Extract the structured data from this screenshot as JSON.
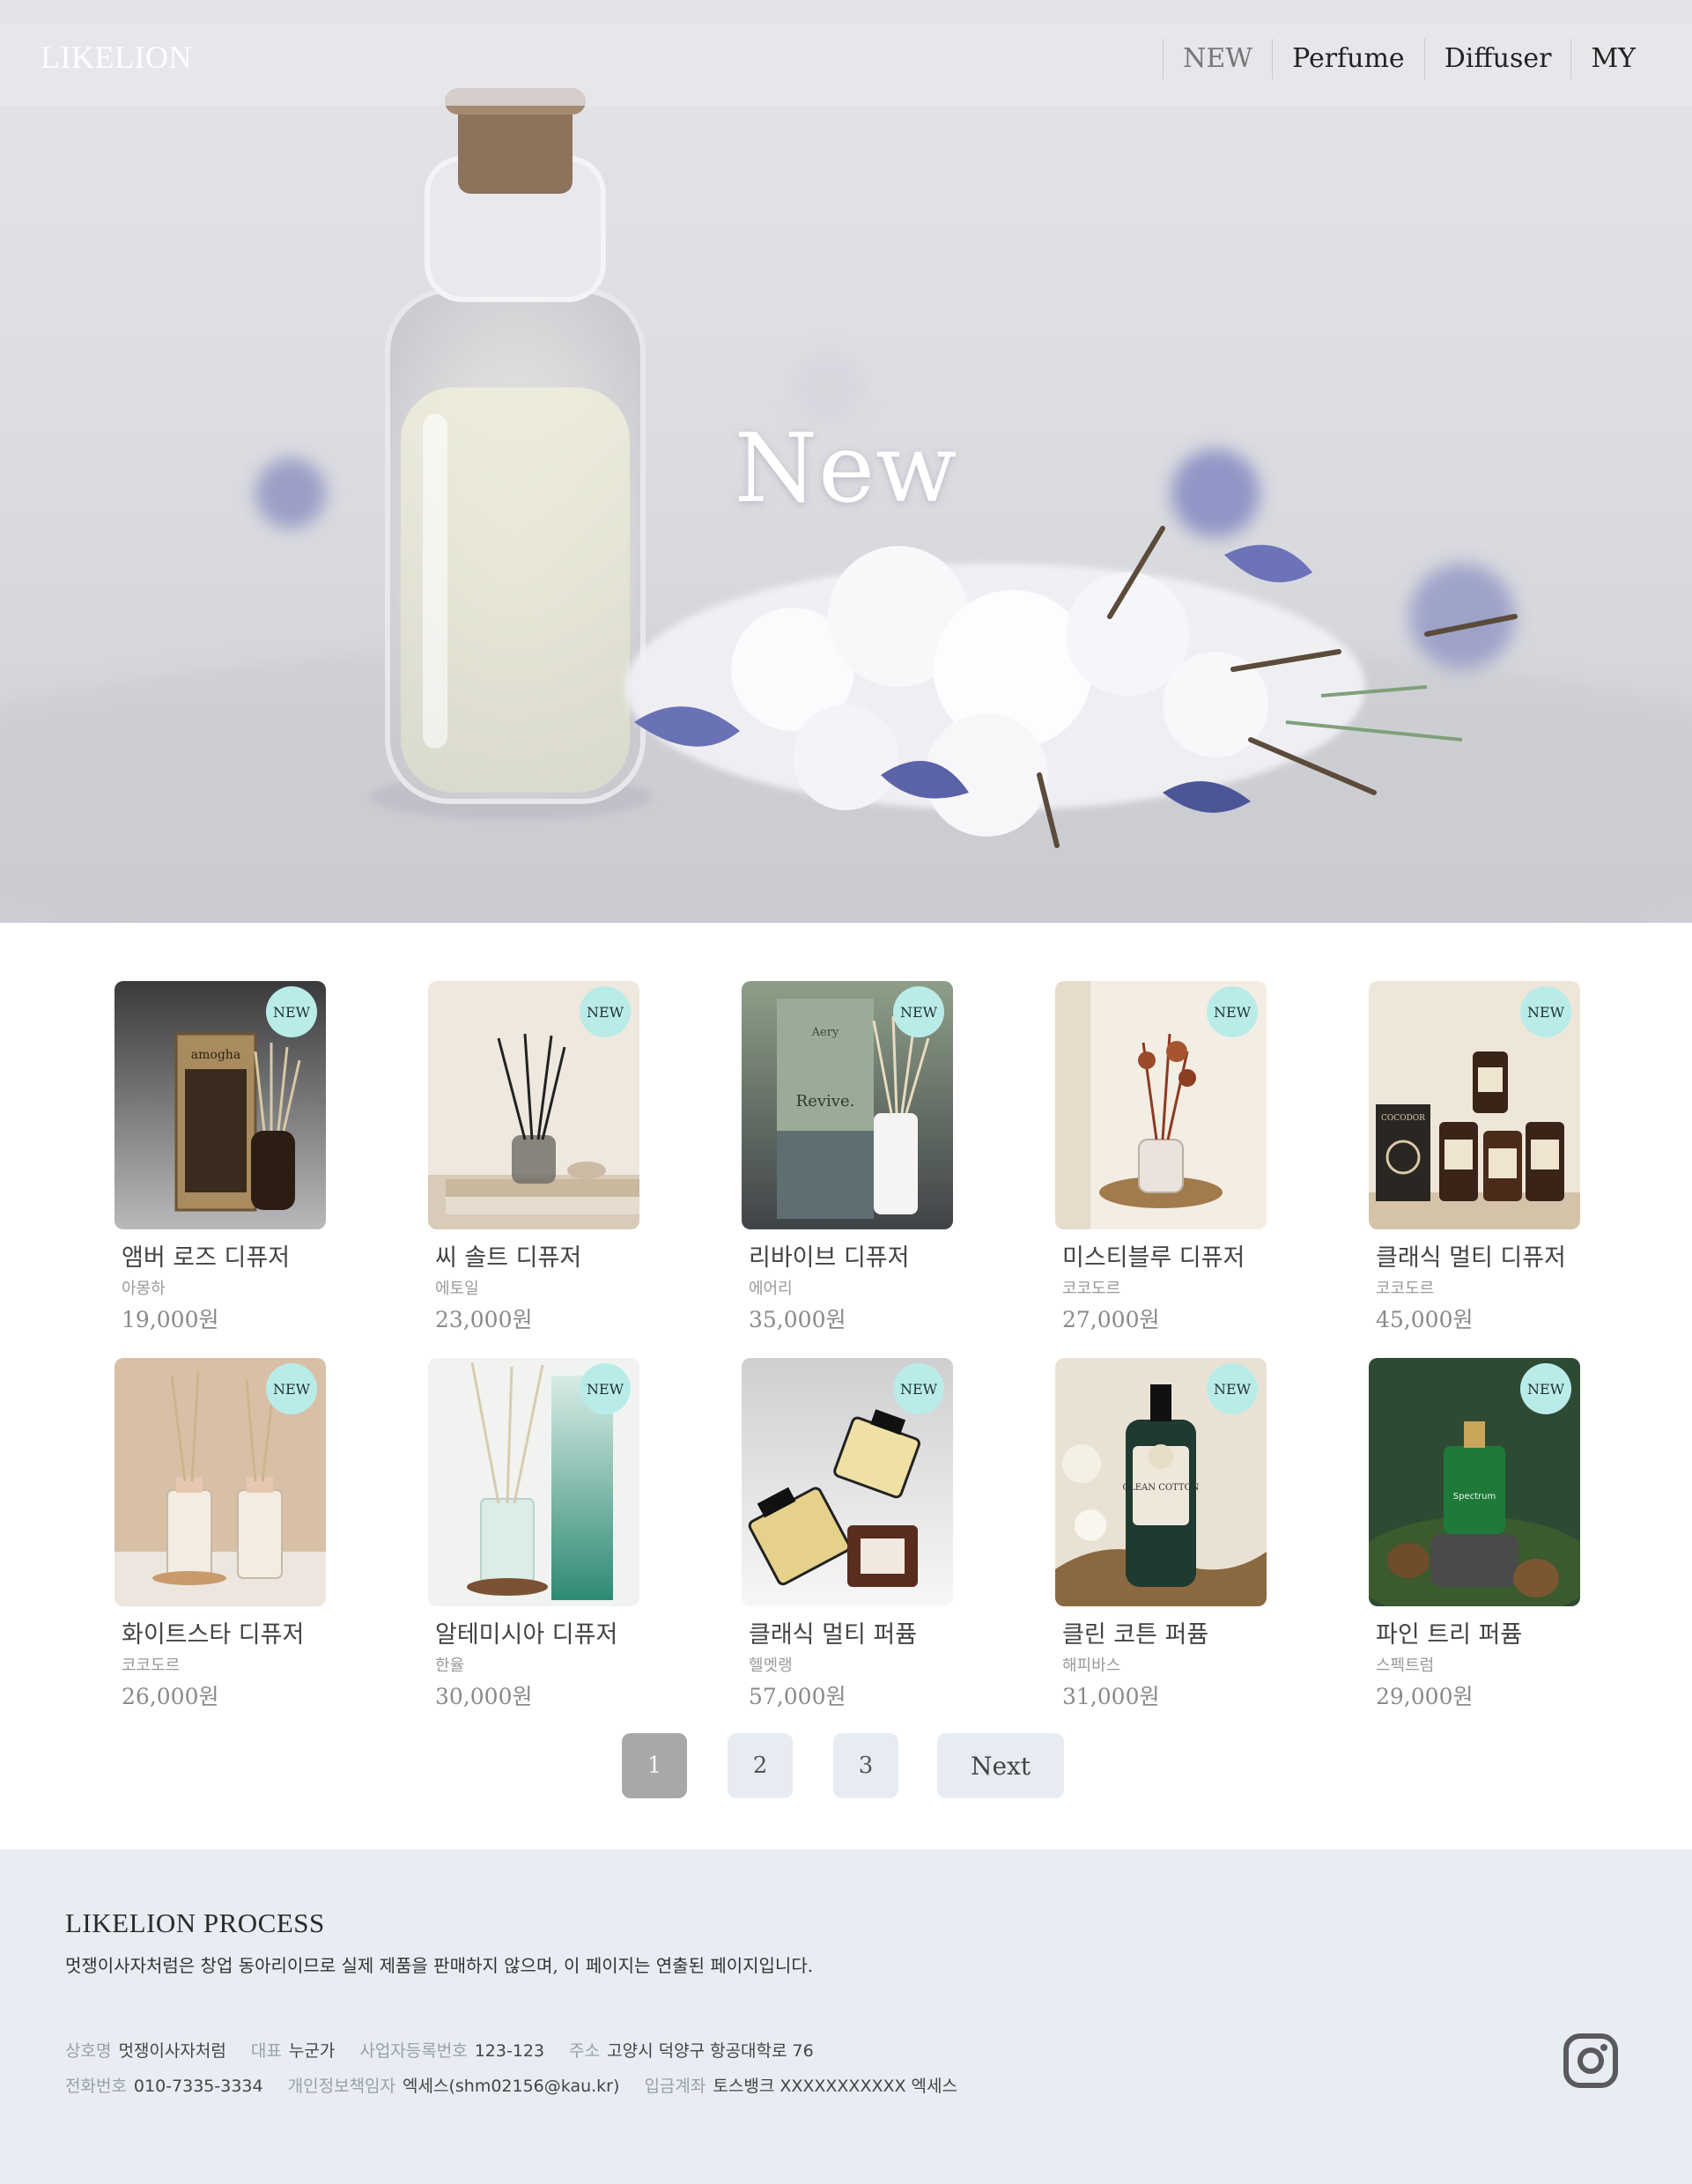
{
  "header": {
    "logo": "LIKELION",
    "nav": [
      "NEW",
      "Perfume",
      "Diffuser",
      "MY"
    ],
    "active_nav": "NEW"
  },
  "hero": {
    "title": "New"
  },
  "products": [
    {
      "name": "앰버 로즈 디퓨저",
      "brand": "아몽하",
      "price": "19,000원",
      "badge": "NEW"
    },
    {
      "name": "씨 솔트 디퓨저",
      "brand": "에토일",
      "price": "23,000원",
      "badge": "NEW"
    },
    {
      "name": "리바이브 디퓨저",
      "brand": "에어리",
      "price": "35,000원",
      "badge": "NEW"
    },
    {
      "name": "미스티블루 디퓨저",
      "brand": "코코도르",
      "price": "27,000원",
      "badge": "NEW"
    },
    {
      "name": "클래식 멀티 디퓨저",
      "brand": "코코도르",
      "price": "45,000원",
      "badge": "NEW"
    },
    {
      "name": "화이트스타 디퓨저",
      "brand": "코코도르",
      "price": "26,000원",
      "badge": "NEW"
    },
    {
      "name": "알테미시아 디퓨저",
      "brand": "한율",
      "price": "30,000원",
      "badge": "NEW"
    },
    {
      "name": "클래식 멀티 퍼퓸",
      "brand": "헬멧랭",
      "price": "57,000원",
      "badge": "NEW"
    },
    {
      "name": "클린 코튼 퍼퓸",
      "brand": "해피바스",
      "price": "31,000원",
      "badge": "NEW"
    },
    {
      "name": "파인 트리 퍼퓸",
      "brand": "스펙트럼",
      "price": "29,000원",
      "badge": "NEW"
    }
  ],
  "product_image_text": {
    "amogha": "amogha",
    "revive": "Revive.",
    "aery": "Aery",
    "cocodor": "COCODOR",
    "clean_cotton": "CLEAN COTTON",
    "spectrum": "Spectrum"
  },
  "pagination": {
    "pages": [
      "1",
      "2",
      "3"
    ],
    "current": "1",
    "next": "Next"
  },
  "footer": {
    "title": "LIKELION PROCESS",
    "description": "멋쟁이사자처럼은 창업 동아리이므로 실제 제품을 판매하지 않으며, 이 페이지는 연출된 페이지입니다.",
    "row1": [
      {
        "label": "상호명",
        "value": "멋쟁이사자처럼"
      },
      {
        "label": "대표",
        "value": "누군가"
      },
      {
        "label": "사업자등록번호",
        "value": "123-123"
      },
      {
        "label": "주소",
        "value": "고양시 덕양구 항공대학로 76"
      }
    ],
    "row2": [
      {
        "label": "전화번호",
        "value": "010-7335-3334"
      },
      {
        "label": "개인정보책임자",
        "value": "엑세스(shm02156@kau.kr)"
      },
      {
        "label": "입금계좌",
        "value": "토스뱅크 XXXXXXXXXXX 엑세스"
      }
    ],
    "social_icon": "instagram-icon"
  },
  "colors": {
    "badge": "#b9ece9",
    "pager_bg": "#e6ecf2",
    "pager_current": "#a7a8aa",
    "footer_bg": "#e8edf3"
  }
}
